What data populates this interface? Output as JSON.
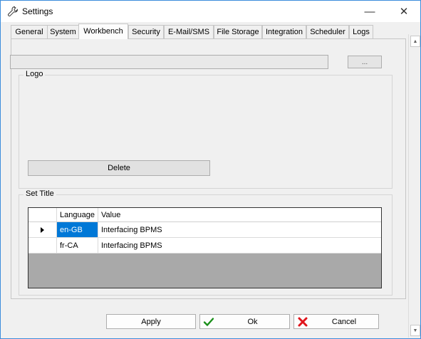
{
  "window": {
    "title": "Settings",
    "minimize_symbol": "—",
    "close_symbol": "✕",
    "accent_color": "#3c8ddc"
  },
  "tabs": [
    {
      "label": "General"
    },
    {
      "label": "System"
    },
    {
      "label": "Workbench",
      "active": true
    },
    {
      "label": "Security"
    },
    {
      "label": "E-Mail/SMS"
    },
    {
      "label": "File Storage"
    },
    {
      "label": "Integration"
    },
    {
      "label": "Scheduler"
    },
    {
      "label": "Logs"
    }
  ],
  "logo": {
    "group_label": "Logo",
    "path_value": "",
    "browse_label": "...",
    "delete_label": "Delete"
  },
  "set_title": {
    "group_label": "Set Title",
    "columns": [
      "Language",
      "Value"
    ],
    "rows": [
      {
        "language": "en-GB",
        "value": "Interfacing BPMS",
        "current": true
      },
      {
        "language": "fr-CA",
        "value": "Interfacing BPMS",
        "current": false
      }
    ],
    "selection_color": "#0078d7"
  },
  "footer": {
    "apply_label": "Apply",
    "ok_label": "Ok",
    "cancel_label": "Cancel",
    "ok_icon": "checkmark-icon",
    "cancel_icon": "x-icon",
    "ok_icon_color": "#1a8f1a",
    "cancel_icon_color": "#e0151c"
  }
}
